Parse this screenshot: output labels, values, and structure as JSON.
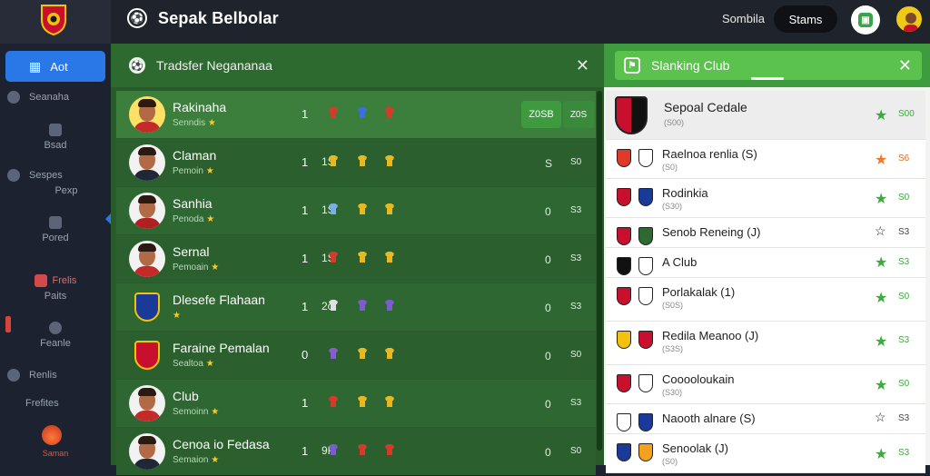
{
  "header": {
    "brand": "Sepak Belbolar",
    "link": "Sombila",
    "pill": "Stams"
  },
  "sidebar": {
    "active": "Aot",
    "items": [
      {
        "label": "Seanaha"
      },
      {
        "label": "Bsad"
      },
      {
        "label": "Sespes"
      },
      {
        "label": "Pexp"
      },
      {
        "label": "Pored"
      },
      {
        "label": "Frelis"
      },
      {
        "label": "Paits"
      },
      {
        "label": "Feanle"
      },
      {
        "label": "Renlis"
      },
      {
        "label": "Frefites"
      }
    ],
    "bottom_label": "Saman"
  },
  "main": {
    "title": "Tradsfer Negananaa",
    "players": [
      {
        "name": "Rakinaha",
        "sub": "Senndis",
        "num": "1",
        "val": "Z0SB",
        "val2": "Z0S",
        "colors": [
          "#d63a2a",
          "#3b6ee0",
          "#d63a2a"
        ]
      },
      {
        "name": "Claman",
        "sub": "Pemoin",
        "num": "1",
        "num2": "1S",
        "val": "S",
        "val2": "S0",
        "colors": [
          "#e7b820",
          "#e7b820",
          "#e7b820"
        ]
      },
      {
        "name": "Sanhia",
        "sub": "Penoda",
        "num": "1",
        "num2": "1S",
        "val": "0",
        "val2": "S3",
        "colors": [
          "#7ab0e8",
          "#e7b820",
          "#e7b820"
        ]
      },
      {
        "name": "Sernal",
        "sub": "Pemoain",
        "num": "1",
        "num2": "1S",
        "val": "0",
        "val2": "S3",
        "colors": [
          "#d63a2a",
          "#e7b820",
          "#e7b820"
        ]
      },
      {
        "name": "Dlesefe Flahaan",
        "sub": "",
        "num": "1",
        "num2": "2o",
        "val": "0",
        "val2": "S3",
        "colors": [
          "#e0e0e0",
          "#7a5cd0",
          "#7a5cd0"
        ]
      },
      {
        "name": "Faraine Pemalan",
        "sub": "Sealtoa",
        "num": "0",
        "num2": "",
        "val": "0",
        "val2": "S0",
        "colors": [
          "#8a5ad0",
          "#e7b820",
          "#e7b820"
        ]
      },
      {
        "name": "Club",
        "sub": "Semoinn",
        "num": "1",
        "num2": "",
        "val": "0",
        "val2": "S3",
        "colors": [
          "#d63a2a",
          "#e7b820",
          "#e7b820"
        ]
      },
      {
        "name": "Cenoa io Fedasa",
        "sub": "Semaion",
        "num": "1",
        "num2": "9R",
        "val": "0",
        "val2": "S0",
        "colors": [
          "#7a5cd0",
          "#d63a2a",
          "#d63a2a"
        ]
      }
    ]
  },
  "panel": {
    "title": "Slanking Club",
    "rows": [
      {
        "name": "Sepoal Cedale",
        "sub": "(S00)",
        "val": "S00",
        "star": "green"
      },
      {
        "name": "Raelnoa renlia (S)",
        "sub": "(S0)",
        "val": "S6",
        "star": "orange"
      },
      {
        "name": "Rodinkia",
        "sub": "(S30)",
        "val": "S0",
        "star": "green"
      },
      {
        "name": "Senob Reneing (J)",
        "sub": "",
        "val": "S3",
        "star": "dark"
      },
      {
        "name": "A Club",
        "sub": "",
        "val": "S3",
        "star": "green"
      },
      {
        "name": "Porlakalak (1)",
        "sub": "(S0S)",
        "val": "S0",
        "star": "green"
      },
      {
        "name": "Redila Meanoo (J)",
        "sub": "(S3S)",
        "val": "S3",
        "star": "green"
      },
      {
        "name": "Cooooloukain",
        "sub": "(S30)",
        "val": "S0",
        "star": "green"
      },
      {
        "name": "Naooth alnare (S)",
        "sub": "",
        "val": "S3",
        "star": "dark"
      },
      {
        "name": "Senoolak (J)",
        "sub": "(S0)",
        "val": "S3",
        "star": "green"
      }
    ]
  },
  "colors": {
    "accent": "#2a78e8",
    "green": "#3f9c3e",
    "star": "#ffc928"
  }
}
